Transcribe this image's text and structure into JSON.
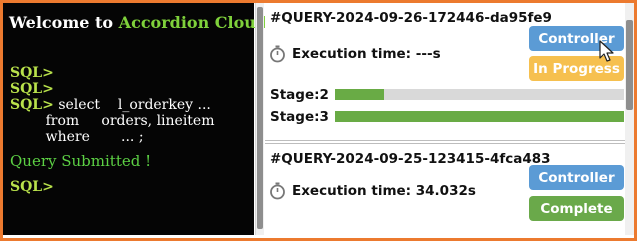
{
  "terminal": {
    "welcome_prefix": "Welcome to ",
    "brand": "Accordion Cloud !",
    "lines": [
      {
        "prompt": "SQL>",
        "text": ""
      },
      {
        "prompt": "SQL>",
        "text": ""
      },
      {
        "prompt": "SQL>",
        "text": " select    l_orderkey ..."
      },
      {
        "prompt": "",
        "text": "        from     orders, lineitem"
      },
      {
        "prompt": "",
        "text": "        where       ... ;"
      }
    ],
    "submitted": "Query Submitted !",
    "final_prompt": "SQL>"
  },
  "queries": [
    {
      "id": "#QUERY-2024-09-26-172446-da95fe9",
      "exec_label": "Execution time: ---s",
      "controller_label": "Controller",
      "status_label": "In Progress",
      "stages": [
        {
          "label": "Stage:2",
          "progress": 0.17
        },
        {
          "label": "Stage:3",
          "progress": 1.0
        }
      ]
    },
    {
      "id": "#QUERY-2024-09-25-123415-4fca483",
      "exec_label": "Execution time: 34.032s",
      "controller_label": "Controller",
      "status_label": "Complete"
    }
  ],
  "colors": {
    "frame": "#ec7a2f",
    "terminal_bg": "#050505",
    "brand": "#7fd13b",
    "controller": "#5b9bd5",
    "in_progress": "#f6c04f",
    "complete": "#6aa94a",
    "bar_fill": "#69ab45"
  },
  "icons": {
    "timer": "stopwatch-icon",
    "cursor": "mouse-pointer-icon"
  }
}
